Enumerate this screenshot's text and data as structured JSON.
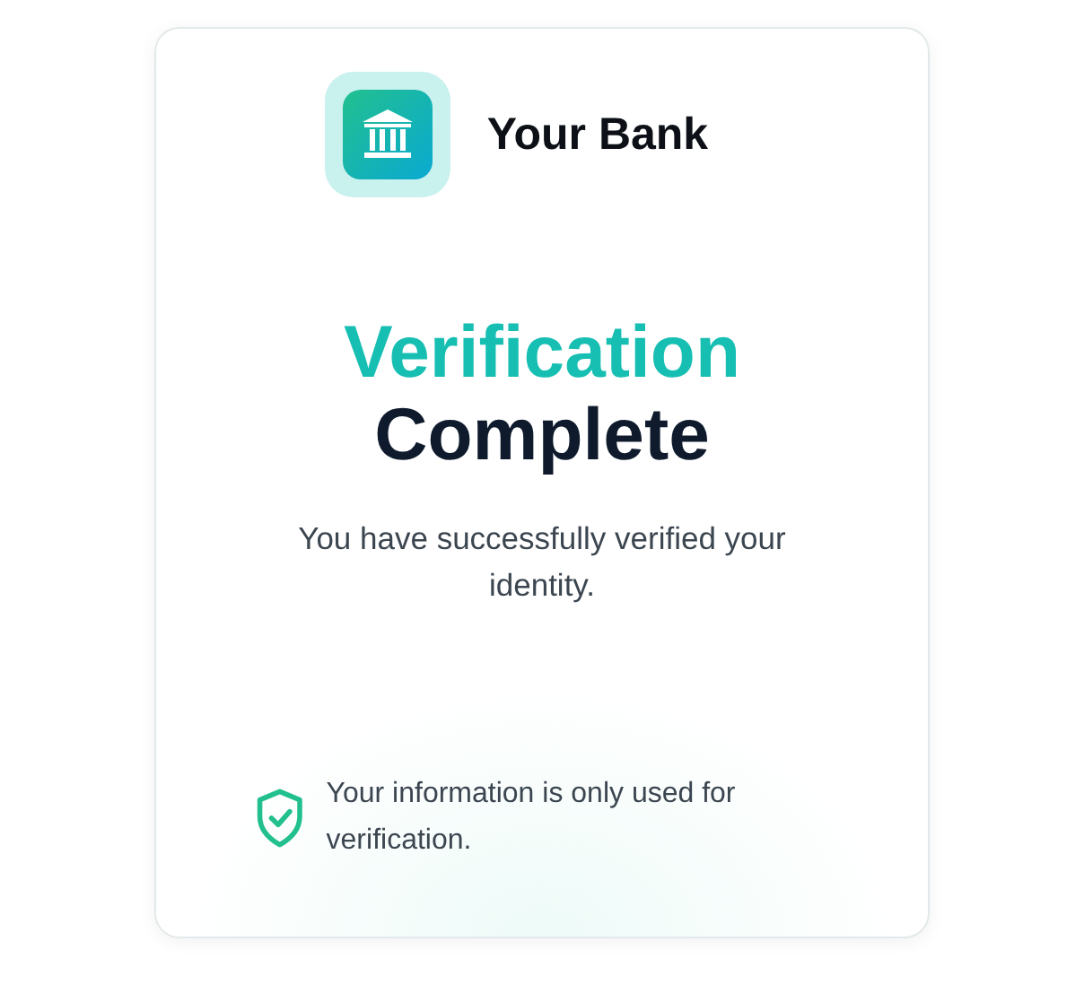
{
  "brand": {
    "name": "Your Bank"
  },
  "heading": {
    "accent": "Verification",
    "main": "Complete"
  },
  "message": "You have successfully verified your identity.",
  "notice": "Your information is only used for verification."
}
